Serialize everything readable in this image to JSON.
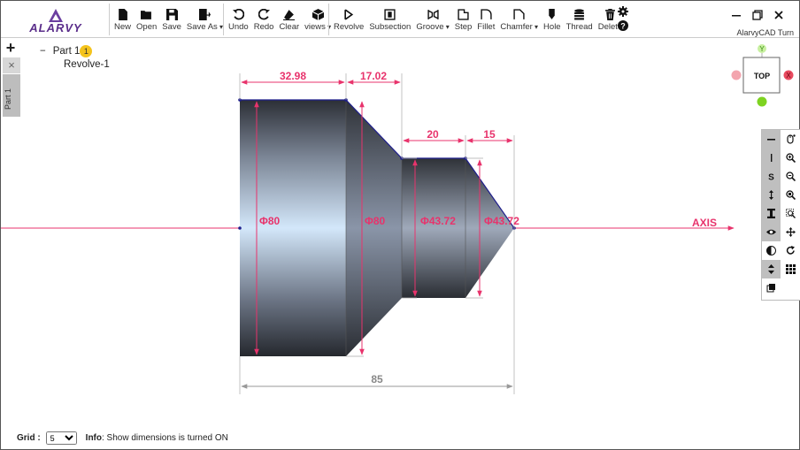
{
  "app": {
    "logo_text": "ALARVY",
    "title": "AlarvyCAD Turn"
  },
  "toolbar": {
    "file": [
      {
        "label": "New",
        "icon": "new-file-icon"
      },
      {
        "label": "Open",
        "icon": "folder-open-icon"
      },
      {
        "label": "Save",
        "icon": "save-icon"
      },
      {
        "label": "Save As",
        "icon": "save-as-icon",
        "dropdown": true
      }
    ],
    "edit": [
      {
        "label": "Undo",
        "icon": "undo-icon"
      },
      {
        "label": "Redo",
        "icon": "redo-icon"
      },
      {
        "label": "Clear",
        "icon": "eraser-icon"
      },
      {
        "label": "views",
        "icon": "cube-icon",
        "dropdown": true
      }
    ],
    "features": [
      {
        "label": "Revolve",
        "icon": "revolve-icon"
      },
      {
        "label": "Subsection",
        "icon": "subsection-icon"
      },
      {
        "label": "Groove",
        "icon": "groove-icon",
        "dropdown": true
      },
      {
        "label": "Step",
        "icon": "step-icon"
      },
      {
        "label": "Fillet",
        "icon": "fillet-icon"
      },
      {
        "label": "Chamfer",
        "icon": "chamfer-icon",
        "dropdown": true
      },
      {
        "label": "Hole",
        "icon": "hole-icon"
      },
      {
        "label": "Thread",
        "icon": "thread-icon"
      },
      {
        "label": "Delete",
        "icon": "trash-icon"
      }
    ]
  },
  "tree": {
    "collapse_symbol": "−",
    "part_label": "Part 1",
    "part_count": "1",
    "feature": "Revolve-1"
  },
  "left_panel": {
    "add": "+",
    "close": "×",
    "tab_label": "Part 1"
  },
  "viewport": {
    "axis_label": "AXIS",
    "dimensions": {
      "top": [
        "32.98",
        "17.02",
        "20",
        "15"
      ],
      "overall": "85",
      "diameters": [
        "Φ80",
        "Φ80",
        "Φ43.72",
        "Φ43.72"
      ]
    }
  },
  "navcube": {
    "face": "TOP",
    "y_label": "Y",
    "x_label": "X"
  },
  "right_tools": {
    "col1": [
      "—",
      "|",
      "S",
      "↕",
      "I",
      "eye",
      "contrast",
      "updown",
      "settings-small"
    ],
    "col2": [
      "mouse",
      "zoom-in",
      "zoom-out",
      "zoom-fit",
      "zoom-window",
      "pan",
      "rotate",
      "grid"
    ]
  },
  "status": {
    "grid_label": "Grid :",
    "grid_value": "5",
    "info_label": "Info",
    "info_text": ": Show dimensions is turned ON"
  },
  "colors": {
    "dimension": "#e8336c",
    "axis": "#e8336c",
    "badge": "#f4c31c",
    "body_outline": "#1e1e8c",
    "x_ball": "#e84a5f",
    "y_ball": "#7ed321"
  }
}
